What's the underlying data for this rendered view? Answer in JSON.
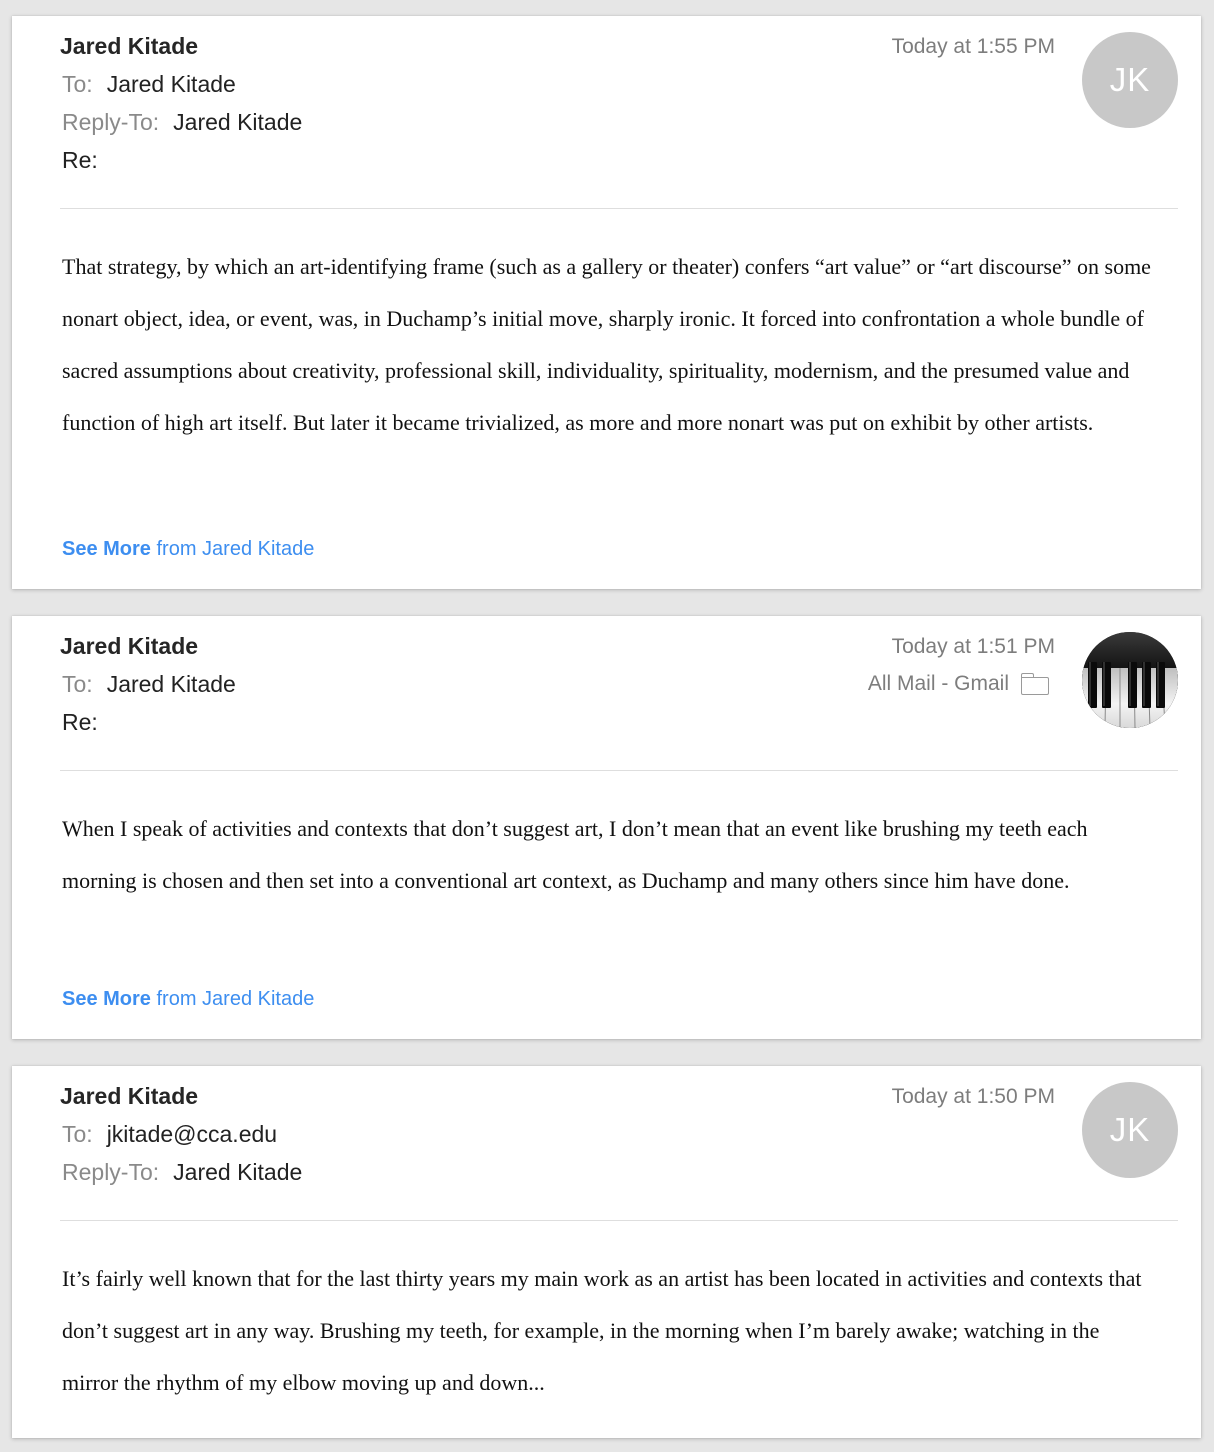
{
  "messages": [
    {
      "sender": "Jared Kitade",
      "date": "Today at 1:55 PM",
      "to_label": "To:",
      "to": "Jared Kitade",
      "reply_to_label": "Reply-To:",
      "reply_to": "Jared Kitade",
      "re_label": "Re:",
      "avatar_initials": "JK",
      "body": "That strategy, by which an art-identifying frame (such as a gallery or theater) confers “art value” or “art discourse” on some nonart object, idea, or event, was, in Duchamp’s initial move, sharply ironic. It forced into confrontation a whole bundle of sacred assumptions about creativity, professional skill, individuality, spirituality, modernism, and the presumed value and function of high art itself. But later it became trivialized, as more and more nonart was put on exhibit by other artists.",
      "see_more": "See More",
      "see_more_from": "from Jared Kitade"
    },
    {
      "sender": "Jared Kitade",
      "date": "Today at 1:51 PM",
      "mailbox": "All Mail - Gmail",
      "mailbox_icon": "folder-icon",
      "to_label": "To:",
      "to": "Jared Kitade",
      "re_label": "Re:",
      "avatar_image": "piano-keys-photo",
      "body": "When I speak of activities and contexts that don’t suggest art, I don’t mean that an event like brushing my teeth each morning is chosen and then set into a conventional art context, as Duchamp and many others since him have done.",
      "see_more": "See More",
      "see_more_from": "from Jared Kitade"
    },
    {
      "sender": "Jared Kitade",
      "date": "Today at 1:50 PM",
      "to_label": "To:",
      "to": "jkitade@cca.edu",
      "reply_to_label": "Reply-To:",
      "reply_to": "Jared Kitade",
      "avatar_initials": "JK",
      "body": "It’s fairly well known that for the last thirty years my main work as an artist has been located in activities and contexts that don’t suggest art in any way. Brushing my teeth, for example, in the morning when I’m barely awake; watching in the mirror the rhythm of my elbow moving up and down..."
    }
  ],
  "colors": {
    "link": "#3d8ef0",
    "avatar_bg": "#c8c8c8",
    "label": "#8a8a8a",
    "background": "#e6e6e6"
  }
}
